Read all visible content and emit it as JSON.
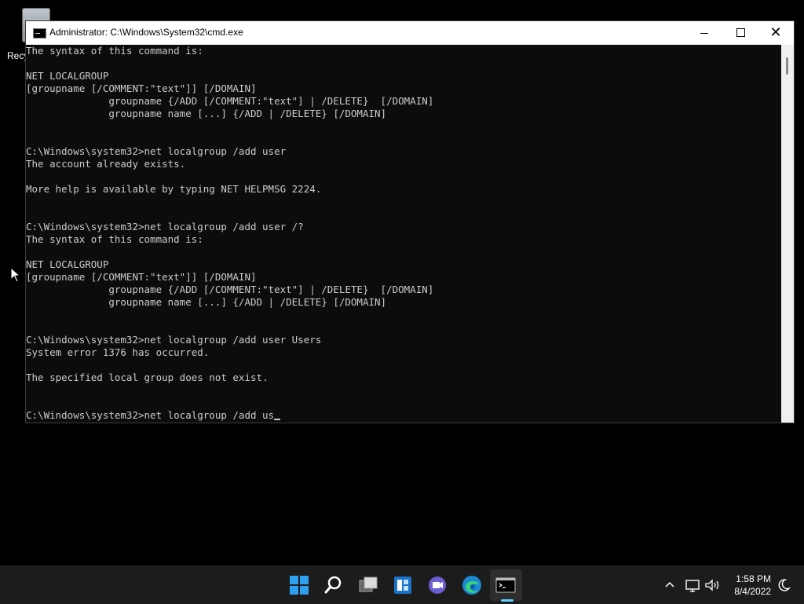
{
  "desktop": {
    "recycle_bin_label": "Recy"
  },
  "window": {
    "title": "Administrator: C:\\Windows\\System32\\cmd.exe",
    "minimize_glyph": "",
    "maximize_glyph": "",
    "close_glyph": "✕"
  },
  "console": {
    "lines": [
      "The syntax of this command is:",
      "",
      "NET LOCALGROUP",
      "[groupname [/COMMENT:\"text\"]] [/DOMAIN]",
      "              groupname {/ADD [/COMMENT:\"text\"] | /DELETE}  [/DOMAIN]",
      "              groupname name [...] {/ADD | /DELETE} [/DOMAIN]",
      "",
      "",
      "C:\\Windows\\system32>net localgroup /add user",
      "The account already exists.",
      "",
      "More help is available by typing NET HELPMSG 2224.",
      "",
      "",
      "C:\\Windows\\system32>net localgroup /add user /?",
      "The syntax of this command is:",
      "",
      "NET LOCALGROUP",
      "[groupname [/COMMENT:\"text\"]] [/DOMAIN]",
      "              groupname {/ADD [/COMMENT:\"text\"] | /DELETE}  [/DOMAIN]",
      "              groupname name [...] {/ADD | /DELETE} [/DOMAIN]",
      "",
      "",
      "C:\\Windows\\system32>net localgroup /add user Users",
      "System error 1376 has occurred.",
      "",
      "The specified local group does not exist.",
      "",
      ""
    ],
    "current_input": "C:\\Windows\\system32>net localgroup /add us"
  },
  "taskbar": {
    "icons": [
      "windows-start-icon",
      "search-icon",
      "task-view-icon",
      "widgets-icon",
      "chat-icon",
      "edge-icon",
      "command-prompt-icon"
    ],
    "clock_time": "1:58 PM",
    "clock_date": "8/4/2022",
    "tray_chevron": "^"
  },
  "colors": {
    "console_bg": "#0c0c0c",
    "console_fg": "#cccccc",
    "taskbar_bg": "#1c1c1c",
    "accent": "#60cdff"
  }
}
